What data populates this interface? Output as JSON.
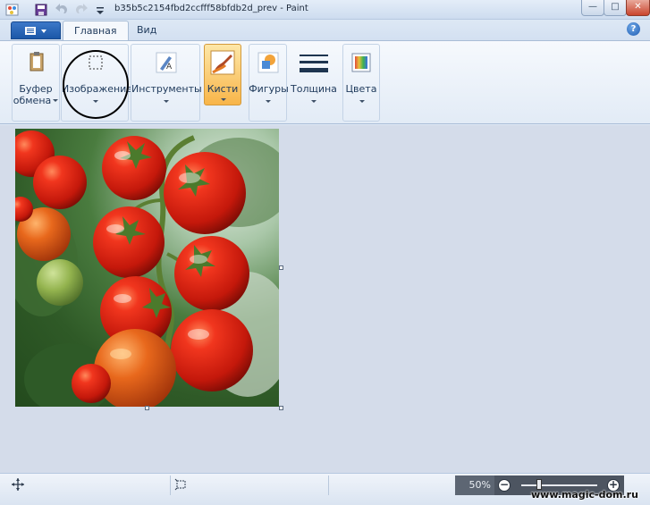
{
  "window": {
    "title": "b35b5c2154fbd2ccfff58bfdb2d_prev - Paint",
    "minimize_glyph": "—",
    "maximize_glyph": "□",
    "close_glyph": "✕"
  },
  "quick_access": {
    "icons": [
      "paint-app-icon",
      "save-icon",
      "undo-icon",
      "redo-icon",
      "customize-qat-icon"
    ]
  },
  "tabs": [
    {
      "label": "Главная",
      "active": true
    },
    {
      "label": "Вид",
      "active": false
    }
  ],
  "help_glyph": "?",
  "ribbon_groups": [
    {
      "label_line1": "Буфер",
      "label_line2": "обмена",
      "icon": "clipboard-icon",
      "selected": false
    },
    {
      "label_line1": "Изображение",
      "label_line2": "",
      "icon": "select-icon",
      "selected": false
    },
    {
      "label_line1": "Инструменты",
      "label_line2": "",
      "icon": "tools-icon",
      "selected": false
    },
    {
      "label_line1": "Кисти",
      "label_line2": "",
      "icon": "brush-icon",
      "selected": true
    },
    {
      "label_line1": "Фигуры",
      "label_line2": "",
      "icon": "shapes-icon",
      "selected": false
    },
    {
      "label_line1": "Толщина",
      "label_line2": "",
      "icon": "line-thickness-icon",
      "selected": false
    },
    {
      "label_line1": "Цвета",
      "label_line2": "",
      "icon": "colors-icon",
      "selected": false
    }
  ],
  "canvas": {
    "image_subject": "ripe red tomatoes on the vine",
    "background_color": "#d4dcea"
  },
  "statusbar": {
    "zoom_label": "50%",
    "zoom_level": 0.5,
    "zoom_out_glyph": "−",
    "zoom_in_glyph": "+"
  },
  "watermark": "www.magic-dom.ru",
  "colors": {
    "accent": "#1b57a8",
    "selected_group": "#f8b549",
    "highlight_circle": "#000000"
  }
}
